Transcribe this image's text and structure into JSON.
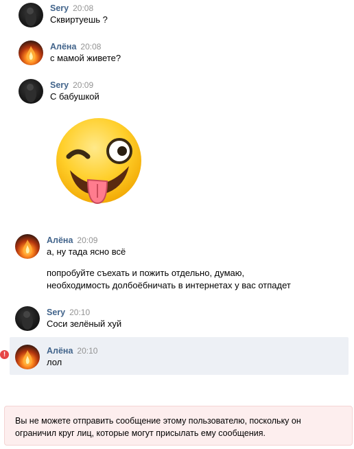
{
  "messages": [
    {
      "author": "Sery",
      "time": "20:08",
      "text": "Сквиртуешь ?"
    },
    {
      "author": "Алёна",
      "time": "20:08",
      "text": "с мамой живете?"
    },
    {
      "author": "Sery",
      "time": "20:09",
      "text": "С бабушкой",
      "sticker": "winking-tongue-emoji"
    },
    {
      "author": "Алёна",
      "time": "20:09",
      "text": "а, ну тада ясно всё",
      "extra_lines": [
        "попробуйте съехать и пожить отдельно, думаю,",
        "необходимость долбоёбничать в интернетах у вас отпадет"
      ]
    },
    {
      "author": "Sery",
      "time": "20:10",
      "text": "Соси зелёный хуй"
    },
    {
      "author": "Алёна",
      "time": "20:10",
      "text": "лол",
      "status": "error",
      "highlighted": true
    }
  ],
  "error_icon": "!",
  "notice": {
    "line1": "Вы не можете отправить сообщение этому пользователю, поскольку он",
    "line2": "ограничил круг лиц, которые могут присылать ему сообщения."
  },
  "colors": {
    "author": "#42648b",
    "time": "#939393",
    "highlight": "#edf0f5",
    "notice_bg": "#fdeeee",
    "error": "#e64646"
  }
}
